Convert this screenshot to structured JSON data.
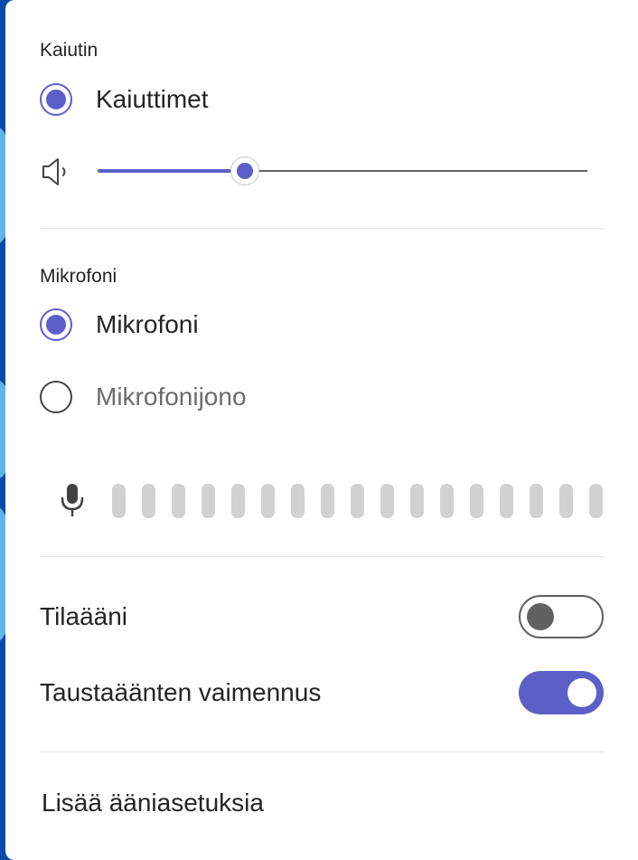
{
  "speaker": {
    "section_label": "Kaiutin",
    "device_label": "Kaiuttimet",
    "icon": "speaker-icon",
    "volume_fraction": 0.3
  },
  "microphone": {
    "section_label": "Mikrofoni",
    "devices": [
      {
        "label": "Mikrofoni",
        "selected": true
      },
      {
        "label": "Mikrofonijono",
        "selected": false
      }
    ],
    "icon": "microphone-icon",
    "level_bars": 17,
    "level_active": 0
  },
  "toggles": {
    "spatial_audio": {
      "label": "Tilaääni",
      "on": false
    },
    "noise_suppression": {
      "label": "Taustaäänten vaimennus",
      "on": true
    }
  },
  "more_settings_link": "Lisää ääniasetuksia",
  "colors": {
    "accent": "#5b5fc7",
    "inactive_bar": "#d1d1d1",
    "text": "#242424"
  }
}
